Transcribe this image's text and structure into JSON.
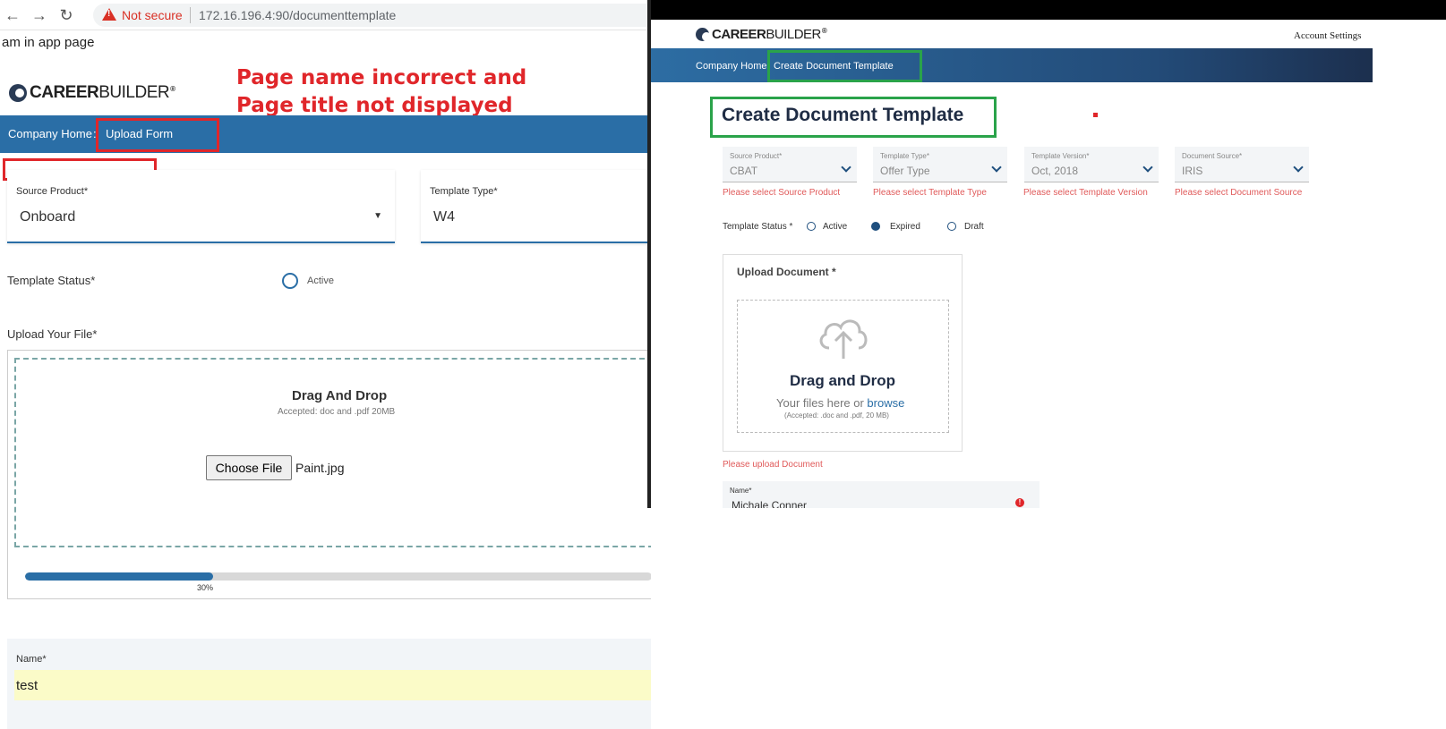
{
  "left": {
    "browser": {
      "not_secure": "Not secure",
      "url": "172.16.196.4:90/documenttemplate"
    },
    "app_message": "am in app page",
    "logo": {
      "bold": "CAREER",
      "rest": "BUILDER",
      "reg": "®"
    },
    "annotation": "Page name incorrect and Page title not displayed",
    "breadcrumb": {
      "home": "Company Home",
      "sep": ":",
      "current": "Upload Form"
    },
    "source_product": {
      "label": "Source Product*",
      "value": "Onboard",
      "caret": "▼"
    },
    "template_type": {
      "label": "Template Type*",
      "value": "W4"
    },
    "template_status": {
      "label": "Template Status*",
      "option": "Active"
    },
    "upload": {
      "label": "Upload Your File*",
      "title": "Drag And Drop",
      "subtitle": "Accepted: doc and .pdf 20MB",
      "choose_button": "Choose File",
      "file_name": "Paint.jpg",
      "progress": 30,
      "progress_label": "30%"
    },
    "name": {
      "label": "Name*",
      "value": "test"
    }
  },
  "right": {
    "logo": {
      "bold": "CAREER",
      "rest": "BUILDER",
      "reg": "®"
    },
    "account_settings": "Account Settings",
    "breadcrumb": {
      "home": "Company Home",
      "sep": ":",
      "current": "Create Document Template"
    },
    "page_title": "Create Document Template",
    "fields": [
      {
        "label": "Source Product*",
        "value": "CBAT",
        "error": "Please select Source Product"
      },
      {
        "label": "Template Type*",
        "value": "Offer Type",
        "error": "Please select Template Type"
      },
      {
        "label": "Template Version*",
        "value": "Oct, 2018",
        "error": "Please select Template Version"
      },
      {
        "label": "Document Source*",
        "value": "IRIS",
        "error": "Please select Document Source"
      }
    ],
    "template_status": {
      "label": "Template Status *",
      "options": [
        "Active",
        "Expired",
        "Draft"
      ],
      "selected": "Expired"
    },
    "upload": {
      "label": "Upload Document *",
      "title": "Drag and Drop",
      "subtitle_prefix": "Your files here or ",
      "browse": "browse",
      "accepted": "(Accepted: .doc and .pdf, 20 MB)",
      "error": "Please upload Document"
    },
    "name": {
      "label": "Name*",
      "value": "Michale Conner",
      "error_icon": "!"
    }
  },
  "colors": {
    "nav_blue": "#2a6ea6",
    "annotation_red": "#e0262a",
    "highlight_green": "#2aa34a",
    "error_red": "#e05a5a",
    "name_highlight": "#fbfbc8"
  }
}
